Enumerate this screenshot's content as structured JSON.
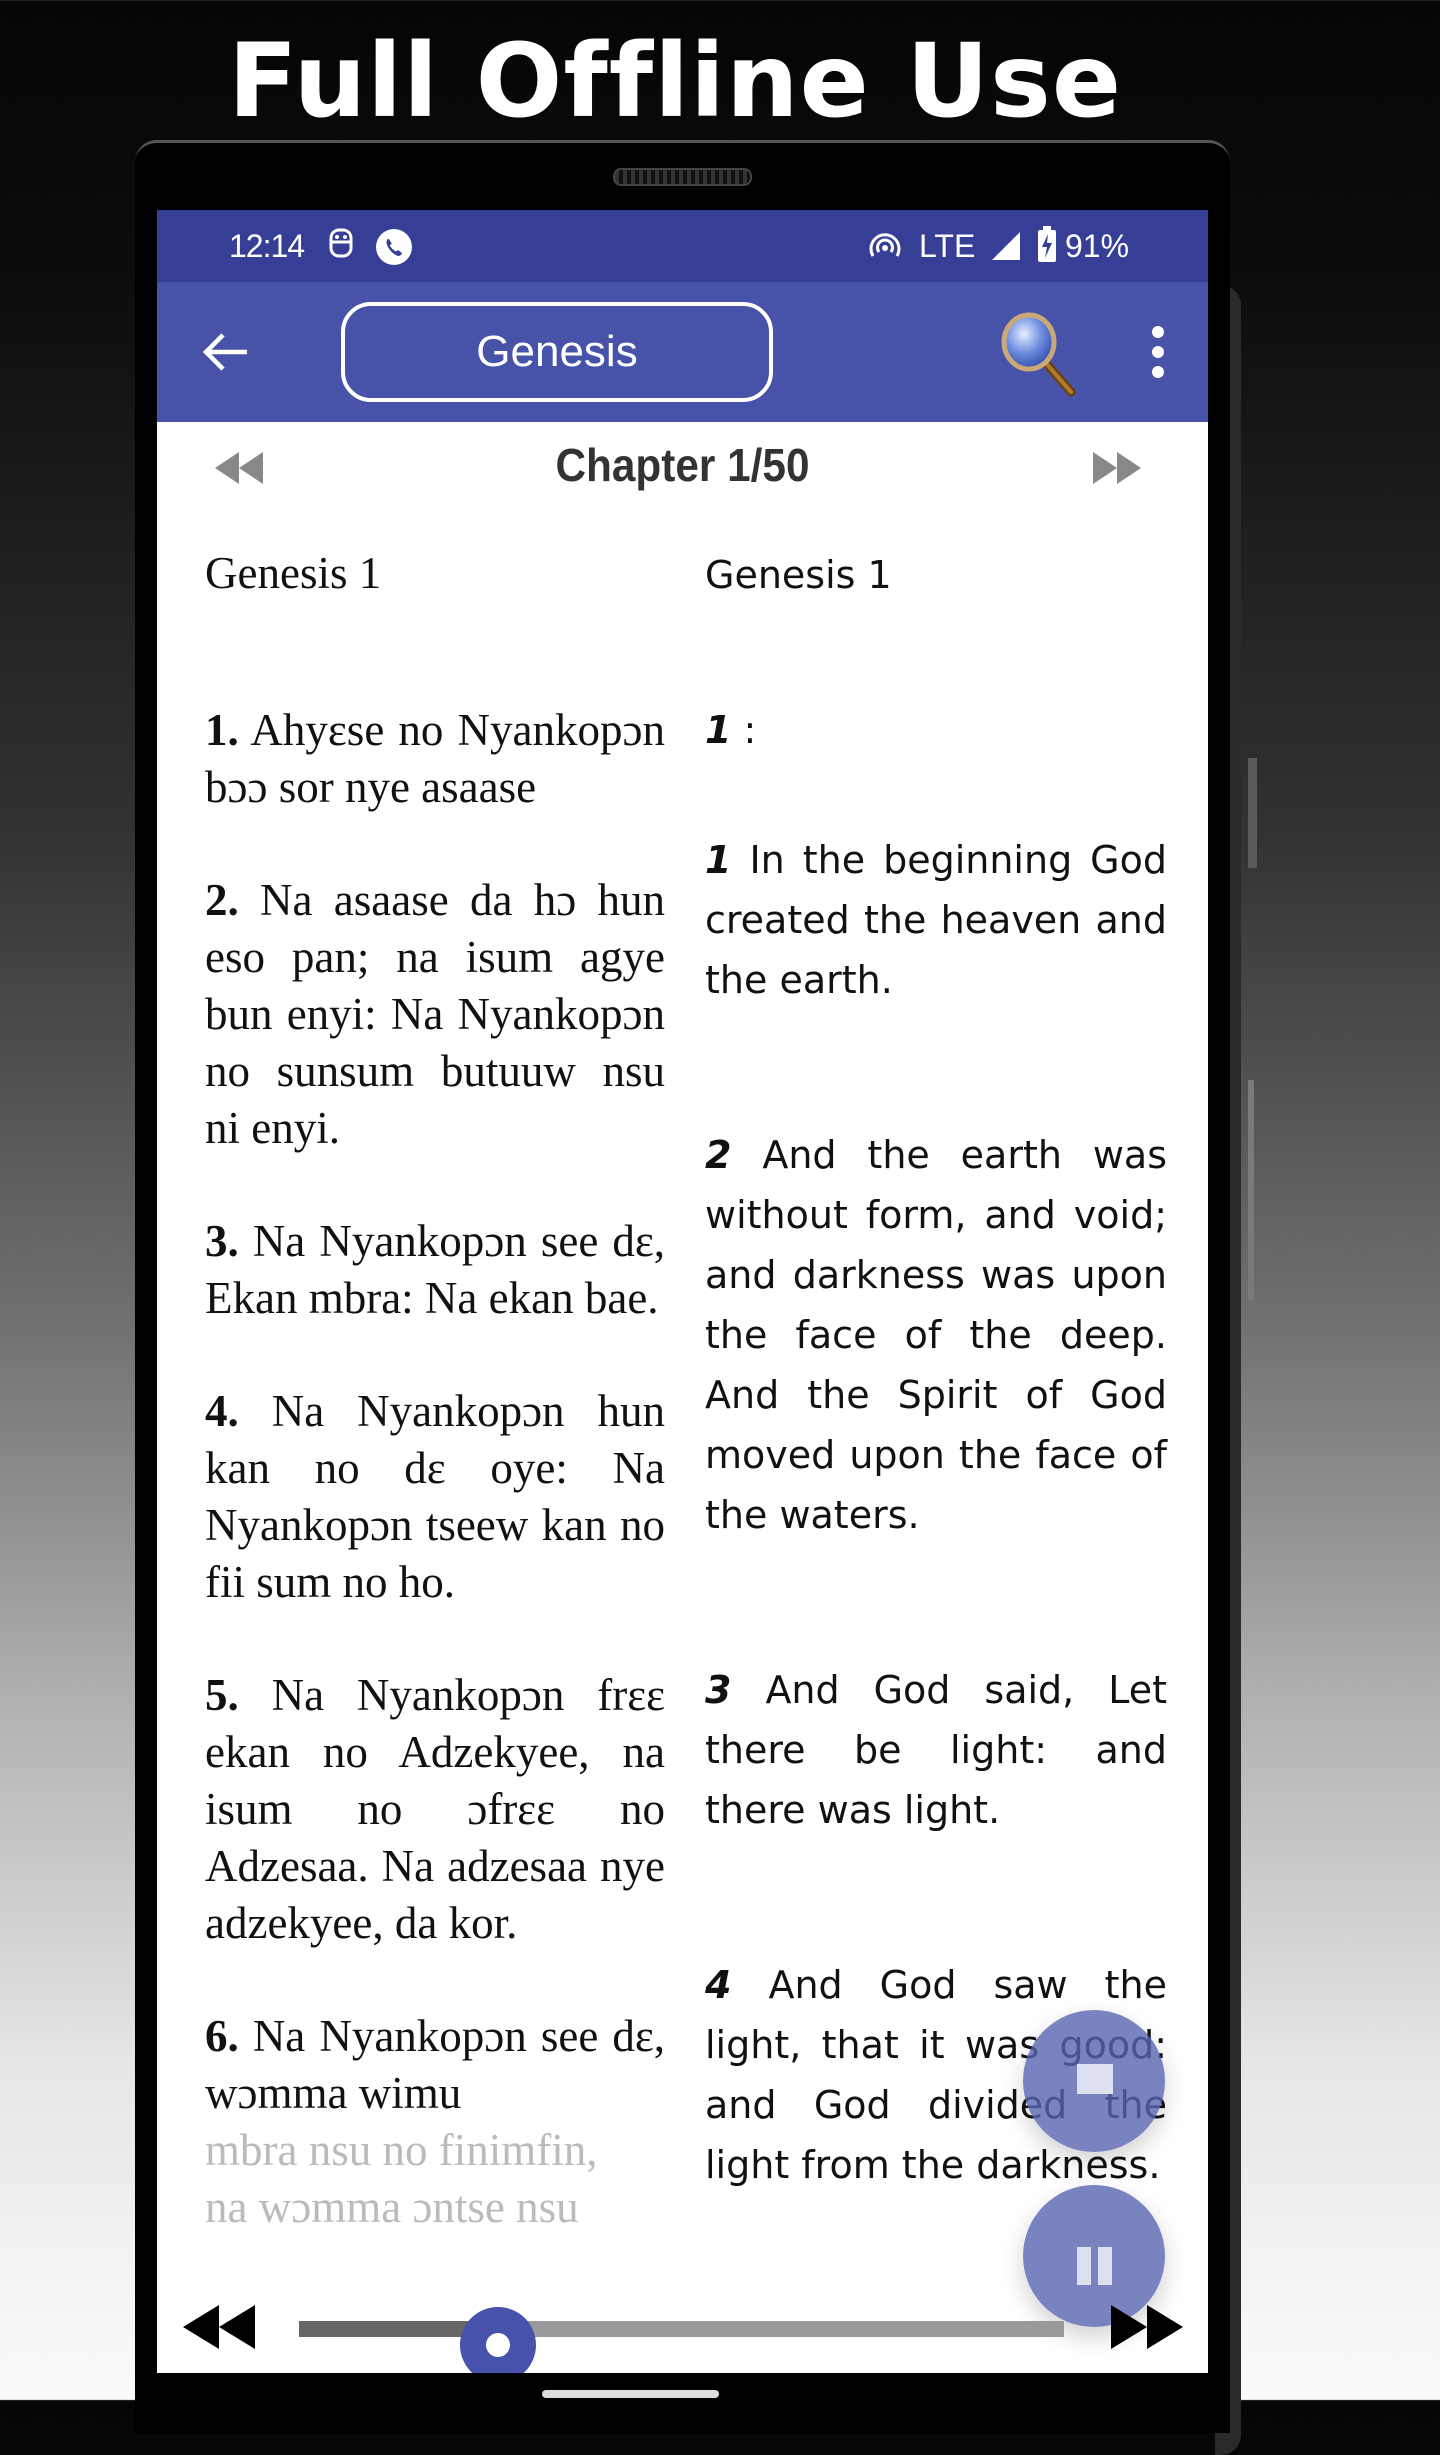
{
  "promo": {
    "headline": "Full Offline Use"
  },
  "status_bar": {
    "time": "12:14",
    "network": "LTE",
    "battery": "91%",
    "icons": [
      "sim-icon",
      "phone-call-icon",
      "hotspot-icon",
      "signal-icon",
      "battery-charging-icon"
    ]
  },
  "app_bar": {
    "back_icon": "arrow-left-icon",
    "book_title": "Genesis",
    "search_icon": "magnifier-icon",
    "menu_icon": "more-vert-icon"
  },
  "chapter_nav": {
    "prev_icon": "rewind-icon",
    "title": "Chapter 1/50",
    "next_icon": "fast-forward-icon"
  },
  "left_column": {
    "heading": "Genesis 1",
    "verses": [
      {
        "num": "1.",
        "text": "Ahyɛse no Nyankopɔn bɔɔ sor nye asaase"
      },
      {
        "num": "2.",
        "text": "Na asaase da hɔ hun eso pan; na isum agye bun enyi: Na Nyankopɔn no sunsum butuuw nsu ni enyi."
      },
      {
        "num": "3.",
        "text": "Na Nyankopɔn see dɛ, Ekan mbra: Na ekan bae."
      },
      {
        "num": "4.",
        "text": "Na Nyankopɔn hun kan no dɛ oye: Na Nyankopɔn tseew kan no fii sum no ho."
      },
      {
        "num": "5.",
        "text": "Na Nyankopɔn frɛɛ ekan no Adzekyee, na isum no ɔfrɛɛ no Adzesaa. Na adzesaa nye adzekyee, da kor."
      },
      {
        "num": "6.",
        "text": "Na Nyankopɔn see dɛ, wɔmma wimu"
      }
    ],
    "faded_lines": [
      "mbra nsu no finimfin,",
      "na wɔmma ɔntse nsu"
    ]
  },
  "right_column": {
    "heading": "Genesis 1",
    "chapter_marker": {
      "num": "1",
      "text": ":"
    },
    "verses": [
      {
        "num": "1",
        "text": "In the beginning God created the heaven and the earth."
      },
      {
        "num": "2",
        "text": "And the earth was without form, and void; and darkness was upon the face of the deep. And the Spirit of God moved upon the face of the waters."
      },
      {
        "num": "3",
        "text": "And God said, Let there be light: and there was light."
      },
      {
        "num": "4",
        "text": "And God saw the light, that it was good: and God divided the light from the darkness."
      }
    ]
  },
  "audio_controls": {
    "stop_icon": "stop-icon",
    "pause_icon": "pause-icon",
    "prev_icon": "rewind-icon",
    "next_icon": "fast-forward-icon",
    "progress_fraction": 0.26
  },
  "colors": {
    "status_bar": "#363f95",
    "app_bar": "#4653a8",
    "accent": "#4652ab",
    "fab": "#5864b0"
  }
}
